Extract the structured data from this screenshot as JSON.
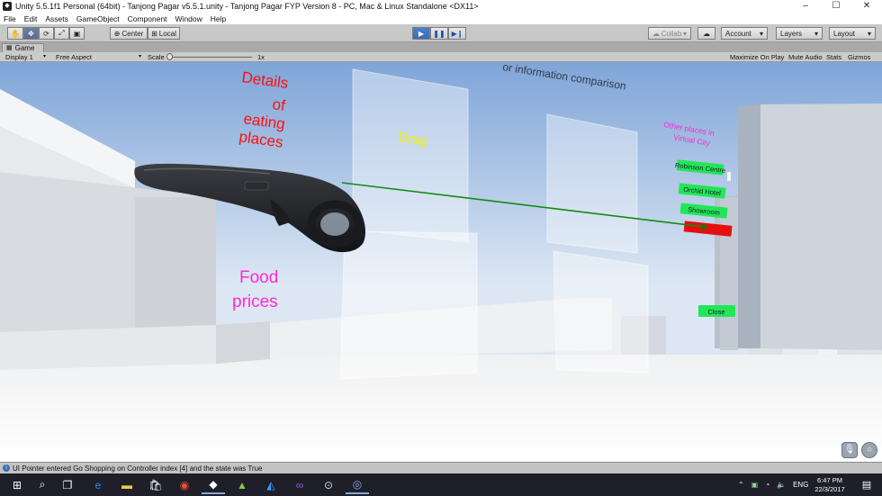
{
  "titlebar": {
    "title": "Unity 5.5.1f1 Personal (64bit) - Tanjong Pagar v5.5.1.unity - Tanjong Pagar FYP Version 8 - PC, Mac & Linux Standalone <DX11>",
    "minimize": "–",
    "maximize": "☐",
    "close": "✕"
  },
  "menu": [
    "File",
    "Edit",
    "Assets",
    "GameObject",
    "Component",
    "Window",
    "Help"
  ],
  "toolbar": {
    "center_label": "Center",
    "local_label": "Local",
    "collab_label": "Collab",
    "account_label": "Account",
    "layers_label": "Layers",
    "layout_label": "Layout",
    "dropdown_arrow": "▾"
  },
  "game_tab": {
    "label": "Game"
  },
  "game_toolbar": {
    "display": "Display 1",
    "aspect": "Free Aspect",
    "scale_label": "Scale",
    "scale_value": "1x",
    "maximize_on_play": "Maximize On Play",
    "mute_audio": "Mute Audio",
    "stats": "Stats",
    "gizmos": "Gizmos"
  },
  "scene": {
    "top_caption": "or information comparison",
    "details_lines": [
      "Details",
      "of",
      "eating",
      "places"
    ],
    "drag_label": "Drag",
    "food_lines": [
      "Food",
      "prices"
    ],
    "other_places_lines": [
      "Other places in",
      "Virtual City"
    ],
    "menu_buttons": [
      "Robinson Centre",
      "Orchid Hotel",
      "Showroom"
    ],
    "close_label": "Close",
    "colors": {
      "sky_top": "#7fa5d8",
      "sky_horizon": "#dde7f3",
      "red_text": "#ff1010",
      "magenta_text": "#ff2ad4",
      "yellow_text": "#f4f000",
      "green_button": "#22e65a",
      "red_button": "#e60f0f",
      "laser": "#138a13"
    }
  },
  "status": {
    "message": "UI Pointer entered Go Shopping on Controller index [4] and the state was True"
  },
  "taskbar": {
    "language": "ENG",
    "time": "6:47 PM",
    "date": "22/3/2017"
  }
}
